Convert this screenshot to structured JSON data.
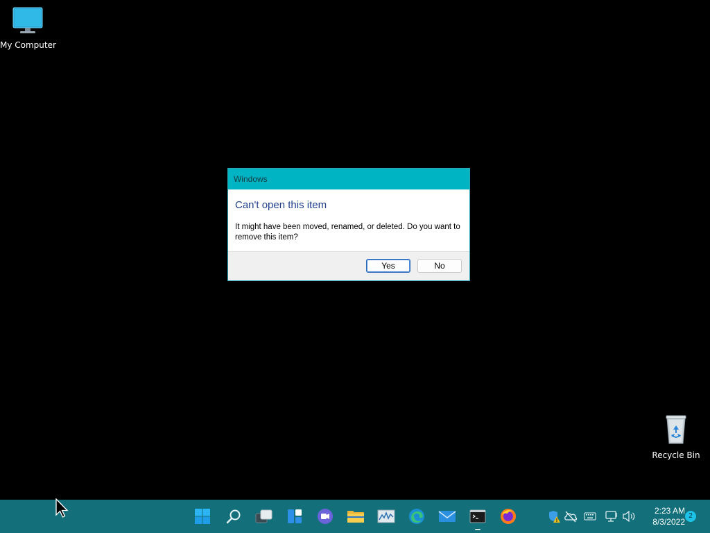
{
  "desktop": {
    "icons": [
      {
        "label": "My Computer",
        "icon": "monitor-icon"
      },
      {
        "label": "Recycle Bin",
        "icon": "recycle-bin-icon"
      }
    ]
  },
  "dialog": {
    "title": "Windows",
    "heading": "Can't open this item",
    "message": "It might have been moved, renamed, or deleted. Do you want to remove this item?",
    "buttons": {
      "yes": "Yes",
      "no": "No"
    }
  },
  "taskbar": {
    "apps": [
      {
        "name": "start",
        "icon": "windows-start-icon"
      },
      {
        "name": "search",
        "icon": "search-icon"
      },
      {
        "name": "task-view",
        "icon": "task-view-icon"
      },
      {
        "name": "widgets",
        "icon": "widgets-icon"
      },
      {
        "name": "chat",
        "icon": "chat-icon"
      },
      {
        "name": "file-explorer",
        "icon": "folder-icon"
      },
      {
        "name": "resource-monitor",
        "icon": "resource-monitor-icon"
      },
      {
        "name": "edge",
        "icon": "edge-icon"
      },
      {
        "name": "mail",
        "icon": "mail-icon"
      },
      {
        "name": "terminal",
        "icon": "terminal-icon",
        "running": true
      },
      {
        "name": "firefox",
        "icon": "firefox-icon"
      }
    ],
    "tray": [
      {
        "icon": "security-warning-icon"
      },
      {
        "icon": "onedrive-off-icon"
      },
      {
        "icon": "keyboard-icon"
      },
      {
        "icon": "network-icon"
      },
      {
        "icon": "volume-icon"
      }
    ],
    "clock": {
      "time": "2:23 AM",
      "date": "8/3/2022"
    },
    "notification_count": "2"
  },
  "colors": {
    "taskbar": "#13707b",
    "dialog_titlebar": "#00b4c4",
    "dialog_heading": "#1f3d8b",
    "desktop": "#000000"
  }
}
